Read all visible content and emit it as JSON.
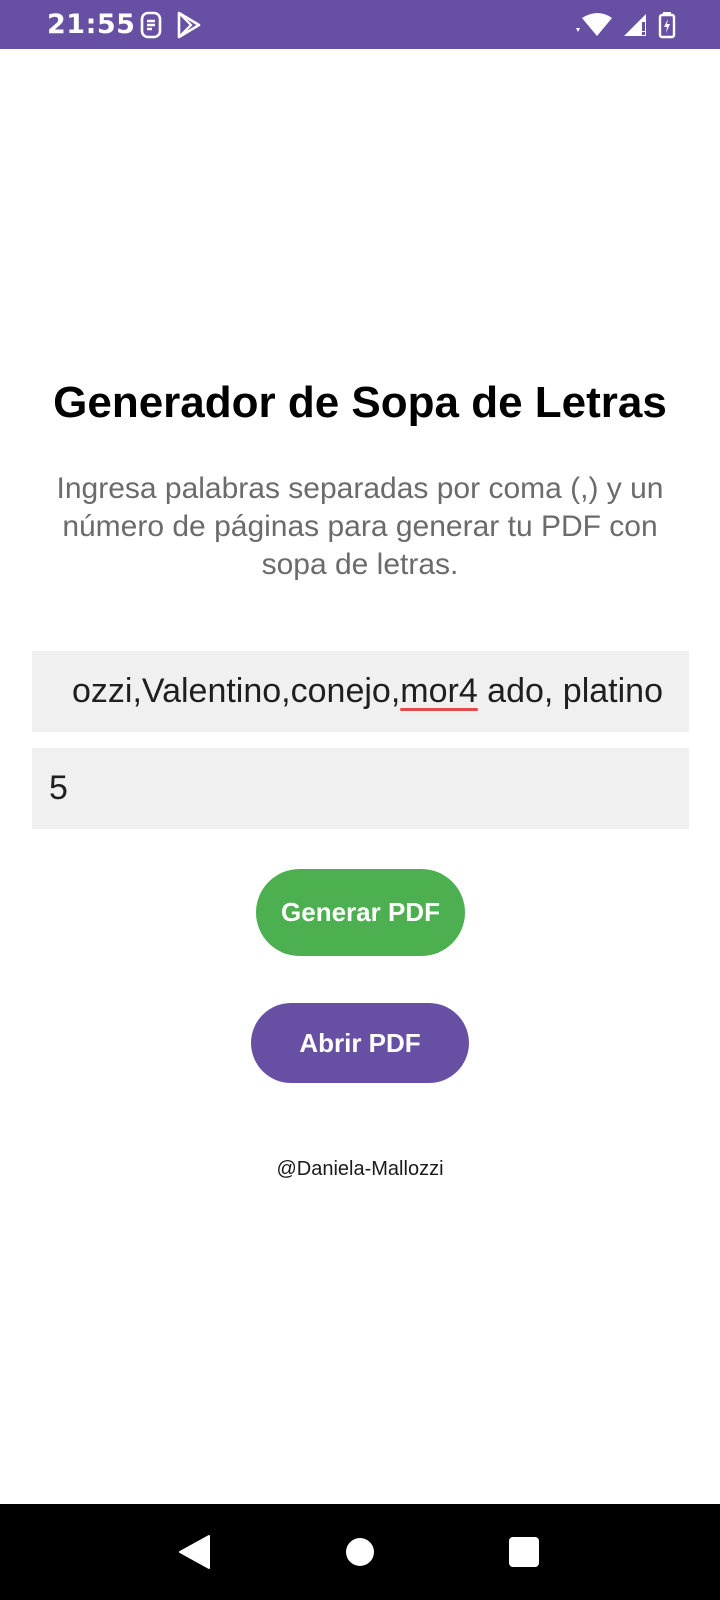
{
  "status_bar": {
    "time": "21:55",
    "left_icons": [
      "notification-icon",
      "play-store-icon"
    ],
    "right_icons": [
      "wifi-icon",
      "cell-signal-icon",
      "battery-charging-icon"
    ],
    "background": "#6750a4"
  },
  "main": {
    "title": "Generador de Sopa de Letras",
    "subtitle": "Ingresa palabras separadas por coma (,) y un número de páginas para generar tu PDF con sopa de letras.",
    "words_input": {
      "value_before": "ozzi,Valentino,conejo,",
      "value_misspelled": "mor4",
      "value_after": " ado, platino"
    },
    "pages_input": {
      "value": "5"
    },
    "generate_button": {
      "label": "Generar PDF",
      "color": "#4caf50"
    },
    "open_button": {
      "label": "Abrir PDF",
      "color": "#6750a4"
    },
    "credit": "@Daniela-Mallozzi"
  },
  "nav_bar": {
    "buttons": [
      "back-icon",
      "home-icon",
      "recents-icon"
    ]
  }
}
